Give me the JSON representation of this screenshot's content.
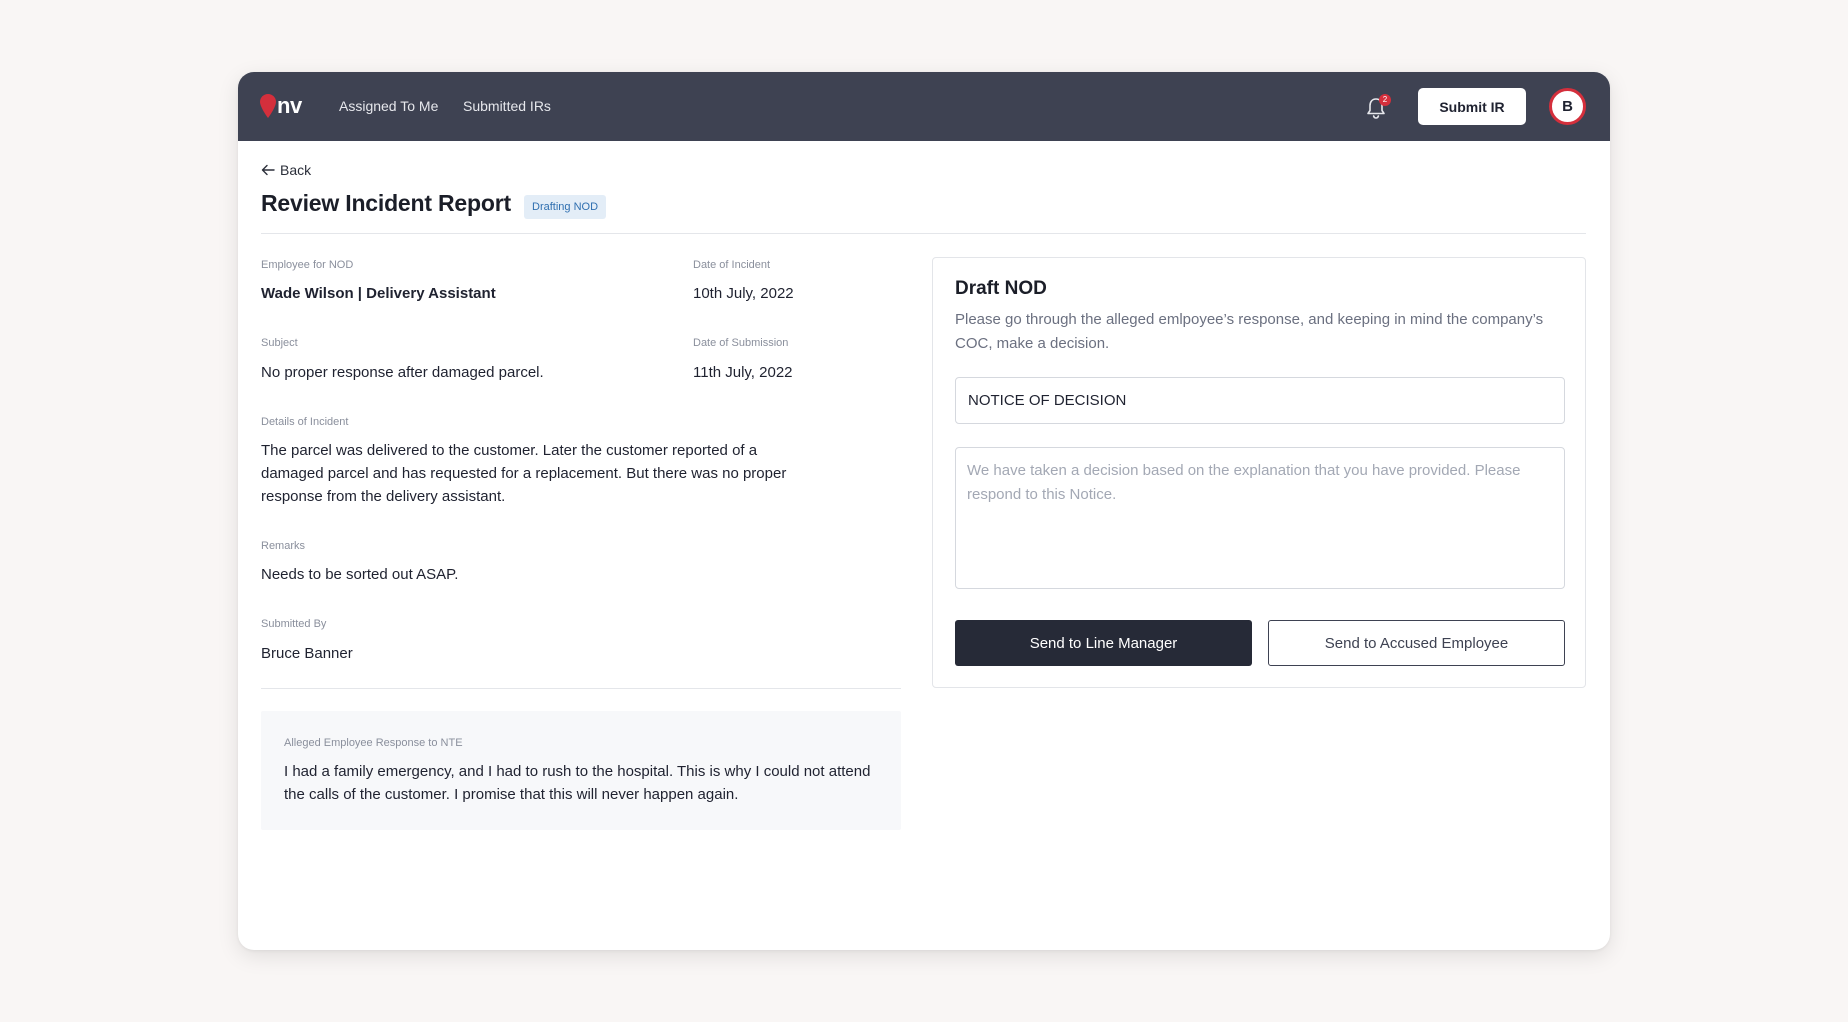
{
  "app": {
    "logo_text": "nv",
    "accent_color": "#d42f3c",
    "topbar_color": "#3e4252"
  },
  "nav": {
    "links": [
      {
        "label": "Assigned To Me"
      },
      {
        "label": "Submitted IRs"
      }
    ],
    "notification_count": "2",
    "submit_label": "Submit IR",
    "avatar_initial": "B"
  },
  "page": {
    "back_label": "Back",
    "title": "Review Incident Report",
    "status": "Drafting NOD"
  },
  "report": {
    "employee_label": "Employee for NOD",
    "employee_value": "Wade Wilson | Delivery Assistant",
    "date_incident_label": "Date of Incident",
    "date_incident_value": "10th July, 2022",
    "subject_label": "Subject",
    "subject_value": "No proper response after damaged parcel.",
    "date_submission_label": "Date of Submission",
    "date_submission_value": "11th July, 2022",
    "details_label": "Details of Incident",
    "details_value": "The parcel was delivered to the customer. Later the customer reported of a damaged parcel and has requested for a replacement. But there was no proper response from the delivery assistant.",
    "remarks_label": "Remarks",
    "remarks_value": "Needs to be sorted out ASAP.",
    "submitted_by_label": "Submitted By",
    "submitted_by_value": "Bruce Banner"
  },
  "response": {
    "label": "Alleged Employee Response to NTE",
    "value": "I had a family emergency, and I had to rush to the hospital. This is why I could not attend the calls of the customer. I promise that this will never happen again."
  },
  "draft": {
    "title": "Draft NOD",
    "description": "Please go through the alleged emlpoyee’s response, and keeping in mind the company’s COC, make a decision.",
    "subject_value": "NOTICE OF DECISION",
    "body_placeholder": "We have taken a decision based on the explanation that you have provided. Please respond to this Notice.",
    "primary_button": "Send to Line Manager",
    "secondary_button": "Send to Accused Employee"
  }
}
